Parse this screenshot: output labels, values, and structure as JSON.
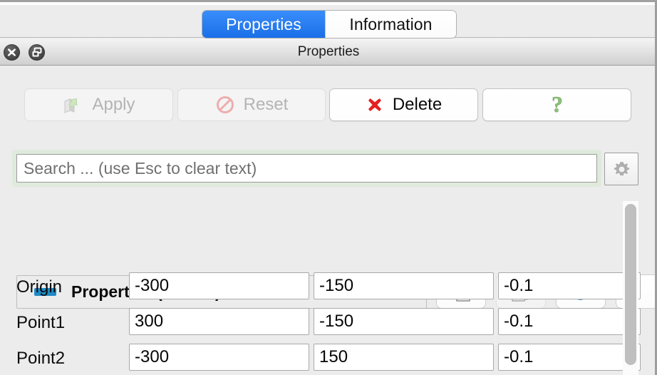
{
  "tabs": [
    {
      "label": "Properties",
      "selected": true
    },
    {
      "label": "Information",
      "selected": false
    }
  ],
  "window": {
    "title": "Properties",
    "close_button": "close",
    "float_button": "float"
  },
  "toolbar": {
    "apply_label": "Apply",
    "apply_enabled": false,
    "reset_label": "Reset",
    "reset_enabled": false,
    "delete_label": "Delete",
    "delete_enabled": true,
    "help_label": "?",
    "help_enabled": true
  },
  "search": {
    "placeholder": "Search ... (use Esc to clear text)",
    "value": "",
    "settings_tooltip": "Settings"
  },
  "group": {
    "title": "Properties (Plane1)",
    "expanded": true,
    "copy_enabled": true,
    "paste_enabled": false,
    "refresh_enabled": true
  },
  "properties": [
    {
      "label": "Origin",
      "x": "-300",
      "y": "-150",
      "z": "-0.1"
    },
    {
      "label": "Point1",
      "x": "300",
      "y": "-150",
      "z": "-0.1"
    },
    {
      "label": "Point2",
      "x": "-300",
      "y": "150",
      "z": "-0.1"
    }
  ],
  "colors": {
    "tab_selected": "#1a6fe8",
    "collapse_bar": "#1e8bc7",
    "refresh_icon": "#1a7fc4",
    "delete_icon": "#e32020",
    "help_icon": "#8cc07a",
    "search_halo": "#dfeadd",
    "background": "#ececec"
  }
}
